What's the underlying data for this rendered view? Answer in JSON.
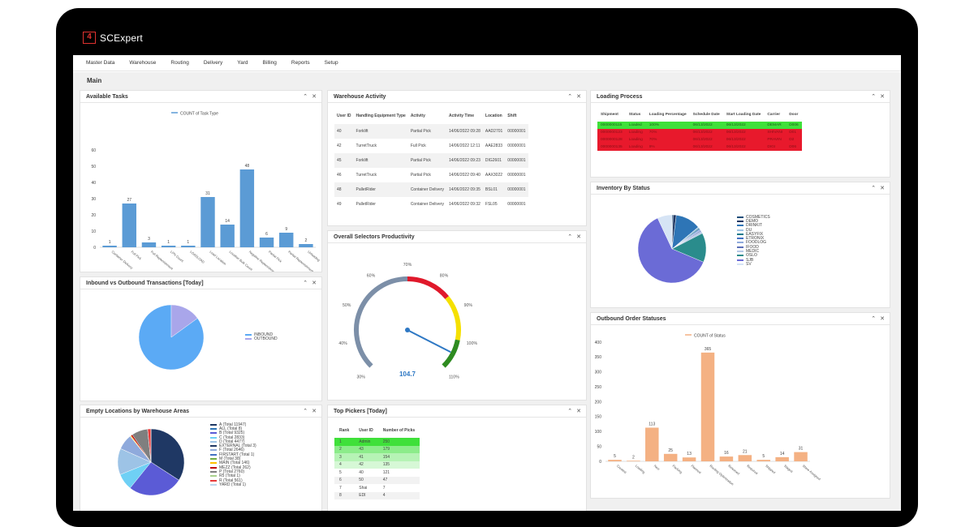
{
  "app": {
    "title": "SCExpert",
    "logo_mark": "4"
  },
  "menu": [
    "Master Data",
    "Warehouse",
    "Routing",
    "Delivery",
    "Yard",
    "Billing",
    "Reports",
    "Setup"
  ],
  "page_title": "Main",
  "panel_controls": {
    "collapse": "⌃",
    "close": "✕"
  },
  "available_tasks": {
    "title": "Available Tasks",
    "chart_data": {
      "type": "bar",
      "legend": "COUNT of Task Type",
      "categories": [
        "Container Delivery",
        "Full Pick",
        "Full Replenishment",
        "LPN Count",
        "LOADLOAD",
        "Load Location",
        "Location Bulk Count",
        "Negative Replenishment",
        "Partial Pick",
        "Partial Replenishment",
        "Unloading"
      ],
      "values": [
        1,
        27,
        3,
        1,
        1,
        31,
        14,
        48,
        6,
        9,
        2
      ],
      "ylim": [
        0,
        60
      ],
      "yticks": [
        0,
        10,
        20,
        30,
        40,
        50,
        60
      ],
      "color": "#5b9bd5"
    }
  },
  "warehouse_activity": {
    "title": "Warehouse Activity",
    "columns": [
      "User ID",
      "Handling Equipment Type",
      "Activity",
      "Activity Time",
      "Location",
      "Shift"
    ],
    "rows": [
      [
        "40",
        "Forklift",
        "Partial Pick",
        "14/06/2022 09:28",
        "AAD2701",
        "00000001"
      ],
      [
        "42",
        "TurretTruck",
        "Full Pick",
        "14/06/2022 12:11",
        "AAE2833",
        "00000001"
      ],
      [
        "45",
        "Forklift",
        "Partial Pick",
        "14/06/2022 09:23",
        "DIG2601",
        "00000001"
      ],
      [
        "46",
        "TurretTruck",
        "Partial Pick",
        "14/06/2022 09:40",
        "AAX3022",
        "00000001"
      ],
      [
        "48",
        "PalletRider",
        "Container Delivery",
        "14/06/2022 09:35",
        "BSL01",
        "00000001"
      ],
      [
        "49",
        "PalletRider",
        "Container Delivery",
        "14/06/2022 09:32",
        "FSL05",
        "00000001"
      ]
    ]
  },
  "loading_process": {
    "title": "Loading Process",
    "columns": [
      "Shipment",
      "Status",
      "Loading Percentage",
      "Schedule Date",
      "Start Loading Date",
      "Carrier",
      "Door"
    ],
    "rows": [
      {
        "cells": [
          "0000000115",
          "Loaded",
          "100%",
          "06/13/2022",
          "06/13/2022",
          "DEMAR",
          "D006"
        ],
        "color": "#3fe03a"
      },
      {
        "cells": [
          "0000000123",
          "Loading",
          "70%",
          "06/13/2022",
          "06/13/2022",
          "SHIVANI",
          "D01"
        ],
        "color": "#e8192c"
      },
      {
        "cells": [
          "0000000128",
          "Loading",
          "70%",
          "06/13/2022",
          "06/13/2022",
          "PRAVIN",
          "D2"
        ],
        "color": "#e8192c"
      },
      {
        "cells": [
          "0000000135",
          "Loading",
          "9%",
          "06/13/2022",
          "06/13/2022",
          "DIGI",
          "D06"
        ],
        "color": "#e8192c"
      }
    ]
  },
  "inventory_by_status": {
    "title": "Inventory By Status",
    "chart_data": {
      "type": "pie",
      "labels": [
        "COSMETICS",
        "DEMO",
        "DRINKIT",
        "DU",
        "EASYFIX",
        "ETRONIX",
        "FOODLOG",
        "IFOOD",
        "MEDIC",
        "OSLO",
        "SJB",
        "SV"
      ],
      "values": [
        0.5,
        1.5,
        12,
        0.5,
        0.5,
        0.5,
        0.5,
        0.5,
        1,
        14,
        62,
        7
      ],
      "colors": [
        "#1f4e79",
        "#203864",
        "#2e75b6",
        "#9dc3e6",
        "#1f7a8c",
        "#4472c4",
        "#8faadc",
        "#5b6fb8",
        "#b4c7e7",
        "#2a8c8c",
        "#6b6bd6",
        "#d6e4f5"
      ]
    }
  },
  "inbound_outbound": {
    "title": "Inbound vs Outbound Transactions [Today]",
    "chart_data": {
      "type": "pie",
      "labels": [
        "INBOUND",
        "OUTBOUND"
      ],
      "values": [
        85,
        15
      ],
      "colors": [
        "#5baaf5",
        "#a9a6ea"
      ]
    }
  },
  "productivity": {
    "title": "Overall Selectors Productivity",
    "value": "104.7",
    "gauge_value": 104.7,
    "min": 30,
    "max": 110,
    "tick_labels": [
      "30%",
      "40%",
      "50%",
      "60%",
      "70%",
      "80%",
      "90%",
      "100%",
      "110%"
    ],
    "bands": [
      {
        "from": 30,
        "to": 70,
        "color": "#7c8fa8"
      },
      {
        "from": 70,
        "to": 85,
        "color": "#e0192b"
      },
      {
        "from": 85,
        "to": 100,
        "color": "#f5e000"
      },
      {
        "from": 100,
        "to": 110,
        "color": "#2e8b20"
      }
    ]
  },
  "outbound_order_statuses": {
    "title": "Outbound Order Statuses",
    "chart_data": {
      "type": "bar",
      "legend": "COUNT of Status",
      "categories": [
        "Created",
        "Loading",
        "New",
        "Packing",
        "Planned",
        "Routing Optimization",
        "Released",
        "Required",
        "Shipped",
        "Staged",
        "Wave Assigned"
      ],
      "values": [
        5,
        2,
        113,
        25,
        13,
        365,
        16,
        21,
        5,
        14,
        31
      ],
      "ylim": [
        0,
        400
      ],
      "yticks": [
        0,
        50,
        100,
        150,
        200,
        250,
        300,
        350,
        400
      ],
      "color": "#f4b183"
    }
  },
  "empty_locations": {
    "title": "Empty Locations by Warehouse Areas",
    "chart_data": {
      "type": "pie",
      "labels": [
        "A (Total 11947)",
        "ALL (Total 8)",
        "B (Total 9325)",
        "C (Total 2833)",
        "D (Total 4477)",
        "EXTERNAL (Total 3)",
        "F (Total 2646)",
        "FIRSTART (Total 1)",
        "M (Total 38)",
        "MAIN (Total 146)",
        "MEZZ (Total 262)",
        "P (Total 2760)",
        "R5 (Total 1)",
        "R (Total 561)",
        "YARD (Total 1)"
      ],
      "values": [
        11947,
        8,
        9325,
        2833,
        4477,
        3,
        2646,
        1,
        38,
        146,
        262,
        2760,
        1,
        561,
        1
      ],
      "colors": [
        "#1f3864",
        "#2e75b6",
        "#5b5bd6",
        "#6fd0f5",
        "#9dc3e6",
        "#203864",
        "#8faadc",
        "#4472c4",
        "#70ad47",
        "#ffc000",
        "#c00000",
        "#7f7f7f",
        "#a9d18e",
        "#e83a3a",
        "#bdd7ee"
      ]
    }
  },
  "top_pickers": {
    "title": "Top Pickers [Today]",
    "columns": [
      "Rank",
      "User ID",
      "Number of Picks"
    ],
    "rows": [
      {
        "cells": [
          "1",
          "Admin",
          "250"
        ],
        "color": "#3fe03a"
      },
      {
        "cells": [
          "2",
          "43",
          "179"
        ],
        "color": "#8cec8a"
      },
      {
        "cells": [
          "3",
          "41",
          "154"
        ],
        "color": "#b6f3b5"
      },
      {
        "cells": [
          "4",
          "42",
          "135"
        ],
        "color": "#d6f8d6"
      },
      {
        "cells": [
          "5",
          "40",
          "121"
        ],
        "color": "#ffffff"
      },
      {
        "cells": [
          "6",
          "50",
          "47"
        ],
        "color": "#f2f2f2"
      },
      {
        "cells": [
          "7",
          "Shai",
          "7"
        ],
        "color": "#ffffff"
      },
      {
        "cells": [
          "8",
          "EDI",
          "4"
        ],
        "color": "#f2f2f2"
      }
    ]
  }
}
